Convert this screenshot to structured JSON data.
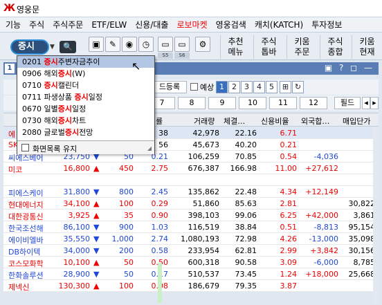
{
  "title": "영웅문",
  "menu": [
    "기능",
    "주식",
    "주식주문",
    "ETF/ELW",
    "신용/대출",
    "로보마켓",
    "영웅검색",
    "캐치(KATCH)",
    "투자정보"
  ],
  "search": {
    "value": "증시"
  },
  "toolbar": {
    "labels": [
      "S5",
      "S6"
    ],
    "right": [
      [
        "추천",
        "메뉴"
      ],
      [
        "주식",
        "톱바"
      ],
      [
        "키움",
        "주문"
      ],
      [
        "주식",
        "종합"
      ],
      [
        "키움",
        "현재"
      ]
    ]
  },
  "panel": {
    "number": "1",
    "icons": "▣ ? ◻ —"
  },
  "controls": {
    "register_button": "드등록",
    "check_label": "예상",
    "num_tabs": [
      "1",
      "2",
      "3",
      "4",
      "5"
    ],
    "period_buttons": [
      "7",
      "8",
      "9",
      "10",
      "11",
      "12"
    ],
    "field_button": "필드"
  },
  "columns": {
    "rate": "률",
    "volume": "거래량",
    "strength": "체결…",
    "credit": "신용비율",
    "foreign": "외국합…",
    "sell": "매입단가"
  },
  "rows": [
    {
      "name": "에",
      "change": "",
      "rate": "38",
      "volume": "42,978",
      "strength": "22.16",
      "credit": "6.71",
      "foreign": "",
      "sell": ""
    },
    {
      "name": "SK",
      "change": "",
      "rate": "56",
      "volume": "45,673",
      "strength": "40.20",
      "credit": "0.21",
      "foreign": "",
      "sell": ""
    },
    {
      "name": "씨에스베어",
      "price": "23,750",
      "dir": "▼",
      "change": "50",
      "rate": "0.21",
      "volume": "106,259",
      "strength": "70.85",
      "credit": "0.54",
      "foreign": "-4,036",
      "sell": ""
    },
    {
      "name": "미코",
      "price": "16,800",
      "dir": "▲",
      "change": "450",
      "rate": "2.75",
      "volume": "676,387",
      "strength": "166.98",
      "credit": "11.00",
      "foreign": "+27,612",
      "sell": ""
    },
    {
      "name": "",
      "price": "",
      "dir": "",
      "change": "",
      "rate": "",
      "volume": "",
      "strength": "",
      "credit": "",
      "foreign": "",
      "sell": ""
    },
    {
      "name": "피에스케이",
      "price": "31,800",
      "dir": "▼",
      "change": "800",
      "rate": "2.45",
      "volume": "135,862",
      "strength": "22.48",
      "credit": "4.34",
      "foreign": "+12,149",
      "sell": ""
    },
    {
      "name": "현대에너지",
      "price": "34,100",
      "dir": "▲",
      "change": "100",
      "rate": "0.29",
      "volume": "51,860",
      "strength": "85.63",
      "credit": "2.81",
      "foreign": "",
      "sell": "30,822"
    },
    {
      "name": "대한광통신",
      "price": "3,925",
      "dir": "▲",
      "change": "35",
      "rate": "0.90",
      "volume": "398,103",
      "strength": "99.06",
      "credit": "6.25",
      "foreign": "+42,000",
      "sell": "3,861"
    },
    {
      "name": "한국조선해",
      "price": "86,100",
      "dir": "▼",
      "change": "900",
      "rate": "1.03",
      "volume": "116,519",
      "strength": "38.84",
      "credit": "0.51",
      "foreign": "-8,813",
      "sell": "95,154"
    },
    {
      "name": "에이비엘바",
      "price": "35,550",
      "dir": "▼",
      "change": "1,000",
      "rate": "2.74",
      "volume": "1,080,193",
      "strength": "72.98",
      "credit": "4.26",
      "foreign": "-13,000",
      "sell": "35,098"
    },
    {
      "name": "DB하이텍",
      "price": "34,000",
      "dir": "▼",
      "change": "200",
      "rate": "0.58",
      "volume": "233,954",
      "strength": "62.81",
      "credit": "2.99",
      "foreign": "+3,842",
      "sell": "30,156"
    },
    {
      "name": "코스모화학",
      "price": "10,100",
      "dir": "▲",
      "change": "50",
      "rate": "0.50",
      "volume": "600,318",
      "strength": "90.58",
      "credit": "3.09",
      "foreign": "-6,000",
      "sell": "8,785"
    },
    {
      "name": "한화솔루션",
      "price": "28,900",
      "dir": "▼",
      "change": "50",
      "rate": "0.17",
      "volume": "510,537",
      "strength": "73.45",
      "credit": "1.24",
      "foreign": "+18,000",
      "sell": "25,668"
    },
    {
      "name": "제넥신",
      "price": "130,300",
      "dir": "▲",
      "change": "100",
      "rate": "0.08",
      "volume": "186,679",
      "strength": "79.35",
      "credit": "3.87",
      "foreign": "",
      "sell": ""
    }
  ],
  "dropdown": {
    "items": [
      {
        "code": "0201",
        "pre": "",
        "hit": "증시",
        "post": "주변자금추이"
      },
      {
        "code": "0906",
        "pre": "해외",
        "hit": "증시",
        "post": "(W)"
      },
      {
        "code": "0710",
        "pre": "",
        "hit": "증시",
        "post": "캘린더"
      },
      {
        "code": "0711",
        "pre": "파생상품 ",
        "hit": "증시",
        "post": "일정"
      },
      {
        "code": "0670",
        "pre": "일별",
        "hit": "증시",
        "post": "일정"
      },
      {
        "code": "0730",
        "pre": "해외",
        "hit": "증시",
        "post": "차트"
      },
      {
        "code": "2080",
        "pre": "글로벌",
        "hit": "증시",
        "post": "전망"
      }
    ],
    "keep_label": "화면목록 유지"
  }
}
